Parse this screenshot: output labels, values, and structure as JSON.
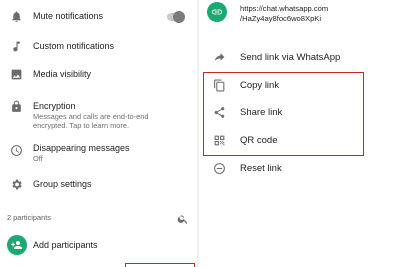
{
  "left": {
    "mute": {
      "label": "Mute notifications",
      "icon": "bell-icon"
    },
    "custom": {
      "label": "Custom notifications",
      "icon": "music-note-icon"
    },
    "media": {
      "label": "Media visibility",
      "icon": "image-icon"
    },
    "encryption": {
      "label": "Encryption",
      "description_line1": "Messages and calls are end-to-end",
      "description_line2": "encrypted. Tap to learn more.",
      "icon": "lock-icon"
    },
    "disappearing": {
      "label": "Disappearing messages",
      "value": "Off",
      "icon": "timer-icon"
    },
    "group_settings": {
      "label": "Group settings",
      "icon": "gear-icon"
    },
    "participants": {
      "count_label": "2 participants",
      "icon": "search-icon"
    },
    "add_participants": {
      "label": "Add participants",
      "icon": "add-person-icon"
    }
  },
  "right": {
    "invite": {
      "url_line1": "https://chat.whatsapp.com",
      "url_line2": "/HaZy4ay8foc6wo8XpKi",
      "icon": "link-icon"
    },
    "send_whatsapp": {
      "label": "Send link via WhatsApp",
      "icon": "forward-arrow-icon"
    },
    "copy": {
      "label": "Copy link",
      "icon": "copy-icon"
    },
    "share": {
      "label": "Share link",
      "icon": "share-icon"
    },
    "qr": {
      "label": "QR code",
      "icon": "qr-code-icon"
    },
    "reset": {
      "label": "Reset link",
      "icon": "minus-circle-icon"
    }
  },
  "colors": {
    "accent": "#1aa971",
    "highlight": "#c62828"
  }
}
